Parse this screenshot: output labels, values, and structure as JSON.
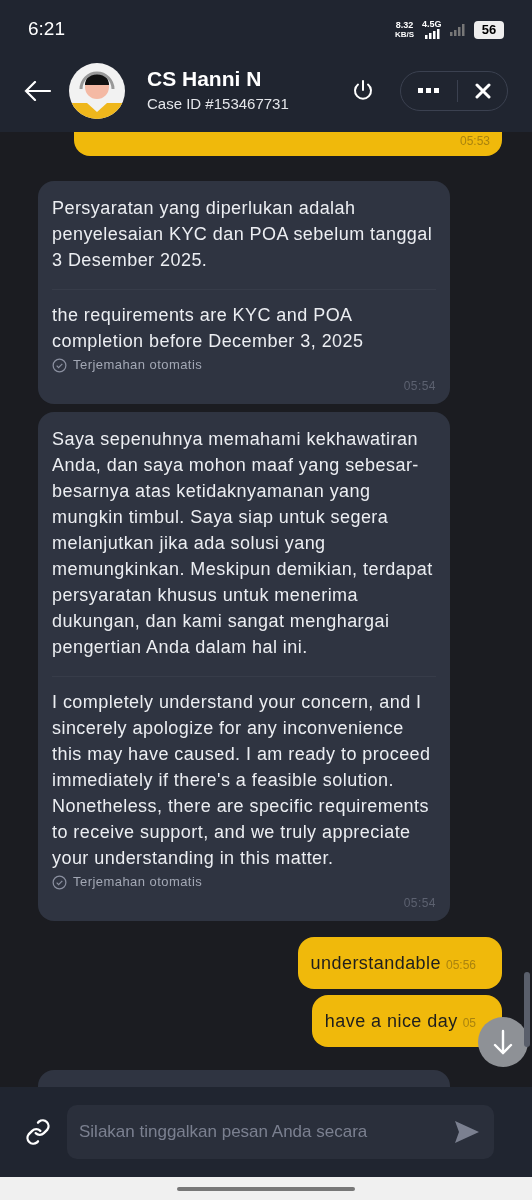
{
  "status_bar": {
    "time": "6:21",
    "speed": "8.32",
    "speed_unit": "KB/S",
    "network": "4.5G",
    "battery": "56"
  },
  "header": {
    "name": "CS Hanni N",
    "case_id": "Case ID #153467731"
  },
  "messages": [
    {
      "kind": "outgoing",
      "time": "05:53",
      "cut": true
    },
    {
      "kind": "incoming",
      "original": "Persyaratan yang diperlukan adalah penyelesaian KYC dan POA sebelum tanggal 3 Desember 2025.",
      "translation": "the requirements are KYC and POA completion before December 3, 2025",
      "note": "Terjemahan otomatis",
      "time": "05:54"
    },
    {
      "kind": "incoming",
      "original": "Saya sepenuhnya memahami kekhawatiran Anda, dan saya mohon maaf yang sebesar-besarnya atas ketidaknyamanan yang mungkin timbul. Saya siap untuk segera melanjutkan jika ada solusi yang memungkinkan. Meskipun demikian, terdapat persyaratan khusus untuk menerima dukungan, dan kami sangat menghargai pengertian Anda dalam hal ini.",
      "translation": "I completely understand your concern, and I sincerely apologize for any inconvenience this may have caused. I am ready to proceed immediately if there's a feasible solution. Nonetheless, there are specific requirements to receive support, and we truly appreciate your understanding in this matter.",
      "note": "Terjemahan otomatis",
      "time": "05:54"
    },
    {
      "kind": "outgoing",
      "text": "understandable",
      "time": "05:56"
    },
    {
      "kind": "outgoing",
      "text": "have a nice day",
      "time": "05"
    },
    {
      "kind": "incoming",
      "cut": true
    }
  ],
  "composer": {
    "placeholder": "Silakan tinggalkan pesan Anda secara"
  }
}
